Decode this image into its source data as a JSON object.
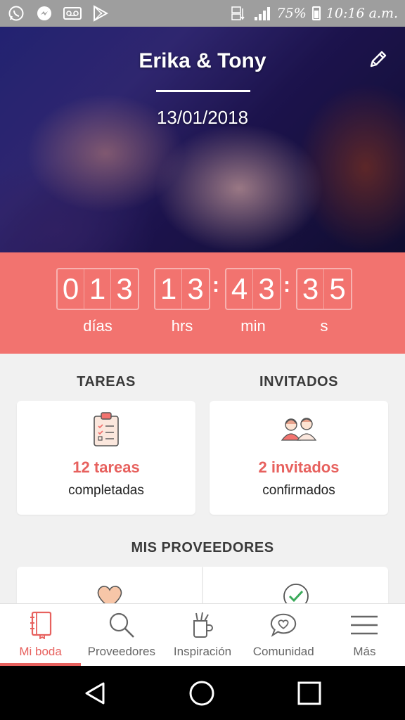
{
  "status_bar": {
    "battery_percent": "75%",
    "time": "10:16 a.m.",
    "icons": [
      "whatsapp-icon",
      "messenger-icon",
      "voicemail-icon",
      "play-store-icon",
      "data-signal-icon",
      "signal-bars-icon",
      "battery-icon"
    ]
  },
  "hero": {
    "couple_names": "Erika & Tony",
    "wedding_date": "13/01/2018",
    "edit_icon": "pencil-icon"
  },
  "countdown": {
    "days": [
      "0",
      "1",
      "3"
    ],
    "hours": [
      "1",
      "3"
    ],
    "minutes": [
      "4",
      "3"
    ],
    "seconds": [
      "3",
      "5"
    ],
    "separator": ":",
    "labels": {
      "days": "días",
      "hours": "hrs",
      "minutes": "min",
      "seconds": "s"
    }
  },
  "tasks": {
    "title": "TAREAS",
    "primary": "12 tareas",
    "secondary": "completadas",
    "icon": "clipboard-checklist-icon"
  },
  "guests": {
    "title": "INVITADOS",
    "primary": "2 invitados",
    "secondary": "confirmados",
    "icon": "guests-couple-icon"
  },
  "vendors": {
    "title": "MIS PROVEEDORES",
    "icons": [
      "heart-icon",
      "check-circle-icon"
    ]
  },
  "bottom_nav": {
    "items": [
      {
        "label": "Mi boda",
        "icon": "notebook-icon",
        "active": true
      },
      {
        "label": "Proveedores",
        "icon": "search-icon",
        "active": false
      },
      {
        "label": "Inspiración",
        "icon": "inspiration-icon",
        "active": false
      },
      {
        "label": "Comunidad",
        "icon": "chat-heart-icon",
        "active": false
      },
      {
        "label": "Más",
        "icon": "menu-icon",
        "active": false
      }
    ]
  },
  "colors": {
    "accent": "#f2736f",
    "accent_text": "#e7615e",
    "status_bar": "#9e9e9e",
    "background": "#f1f1f1"
  }
}
